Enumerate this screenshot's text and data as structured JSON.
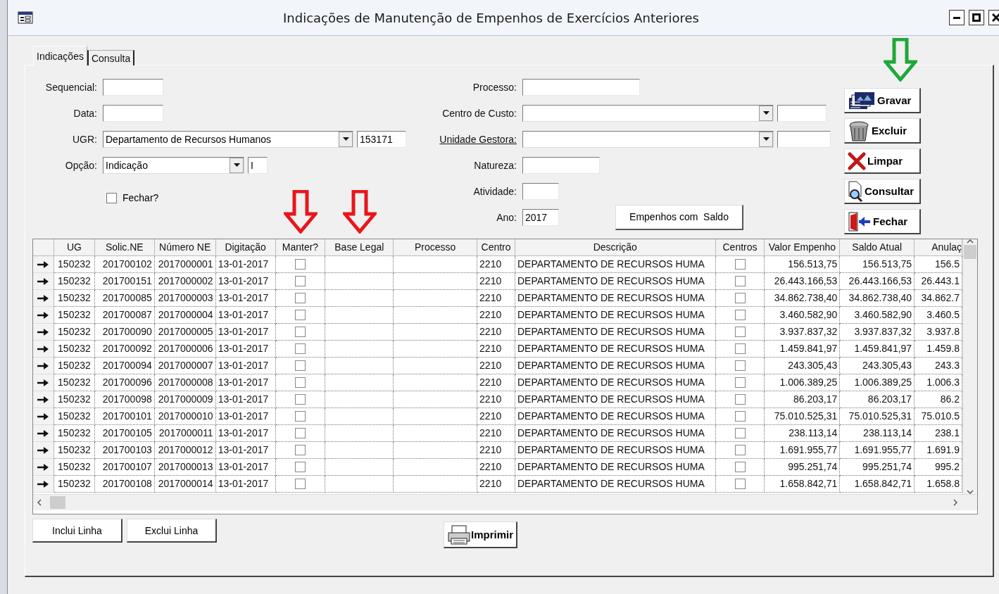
{
  "window": {
    "title": "Indicações de Manutenção de Empenhos de Exercícios Anteriores"
  },
  "tabs": [
    {
      "label": "Indicações",
      "selected": true
    },
    {
      "label": "Consulta",
      "selected": false
    }
  ],
  "form": {
    "left": [
      {
        "kind": "text",
        "label": "Sequencial:"
      },
      {
        "kind": "text",
        "label": "Data:"
      },
      {
        "kind": "combo",
        "label": "UGR:",
        "value": "Departamento de Recursos Humanos",
        "code": "153171"
      },
      {
        "kind": "combo",
        "label": "Opção:",
        "value": "Indicação",
        "code": "I"
      }
    ],
    "fechar": {
      "label": "Fechar?",
      "checked": false
    },
    "right": [
      {
        "kind": "text",
        "label": "Processo:"
      },
      {
        "kind": "combo",
        "label": "Centro de Custo:",
        "underlined": false
      },
      {
        "kind": "combo",
        "label": "Unidade Gestora:",
        "underlined": true
      },
      {
        "kind": "text",
        "label": "Natureza:"
      },
      {
        "kind": "text",
        "label": "Atividade:"
      },
      {
        "kind": "text",
        "label": "Ano:",
        "value": "2017"
      }
    ],
    "empenhos_button": "Empenhos com  Saldo"
  },
  "action_buttons": [
    {
      "kind": "save",
      "label": "Gravar"
    },
    {
      "kind": "delete",
      "label": "Excluir"
    },
    {
      "kind": "clear",
      "label": "Limpar"
    },
    {
      "kind": "query",
      "label": "Consultar"
    },
    {
      "kind": "exit",
      "label": "Fechar"
    }
  ],
  "annotations": [
    {
      "kind": "arrow",
      "color": "#e8161b"
    },
    {
      "kind": "arrow",
      "color": "#e8161b"
    },
    {
      "kind": "arrow",
      "color": "#1fa83a"
    }
  ],
  "table": {
    "columns": [
      "UG",
      "Solic.NE",
      "Número NE",
      "Digitação",
      "Manter?",
      "Base Legal",
      "Processo",
      "Centro",
      "Descrição",
      "Centros",
      "Valor Empenho",
      "Saldo Atual",
      "Anulaç"
    ],
    "rows": [
      {
        "ug": "150232",
        "solic": "201700102",
        "numero": "2017000001",
        "digitacao": "13-01-2017",
        "manter": false,
        "centro": "2210",
        "descricao": "DEPARTAMENTO DE RECURSOS HUMA",
        "centros": false,
        "valor": "156.513,75",
        "saldo": "156.513,75",
        "anulac": "156.5"
      },
      {
        "ug": "150232",
        "solic": "201700151",
        "numero": "2017000002",
        "digitacao": "13-01-2017",
        "manter": false,
        "centro": "2210",
        "descricao": "DEPARTAMENTO DE RECURSOS HUMA",
        "centros": false,
        "valor": "26.443.166,53",
        "saldo": "26.443.166,53",
        "anulac": "26.443.1"
      },
      {
        "ug": "150232",
        "solic": "201700085",
        "numero": "2017000003",
        "digitacao": "13-01-2017",
        "manter": false,
        "centro": "2210",
        "descricao": "DEPARTAMENTO DE RECURSOS HUMA",
        "centros": false,
        "valor": "34.862.738,40",
        "saldo": "34.862.738,40",
        "anulac": "34.862.7"
      },
      {
        "ug": "150232",
        "solic": "201700087",
        "numero": "2017000004",
        "digitacao": "13-01-2017",
        "manter": false,
        "centro": "2210",
        "descricao": "DEPARTAMENTO DE RECURSOS HUMA",
        "centros": false,
        "valor": "3.460.582,90",
        "saldo": "3.460.582,90",
        "anulac": "3.460.5"
      },
      {
        "ug": "150232",
        "solic": "201700090",
        "numero": "2017000005",
        "digitacao": "13-01-2017",
        "manter": false,
        "centro": "2210",
        "descricao": "DEPARTAMENTO DE RECURSOS HUMA",
        "centros": false,
        "valor": "3.937.837,32",
        "saldo": "3.937.837,32",
        "anulac": "3.937.8"
      },
      {
        "ug": "150232",
        "solic": "201700092",
        "numero": "2017000006",
        "digitacao": "13-01-2017",
        "manter": false,
        "centro": "2210",
        "descricao": "DEPARTAMENTO DE RECURSOS HUMA",
        "centros": false,
        "valor": "1.459.841,97",
        "saldo": "1.459.841,97",
        "anulac": "1.459.8"
      },
      {
        "ug": "150232",
        "solic": "201700094",
        "numero": "2017000007",
        "digitacao": "13-01-2017",
        "manter": false,
        "centro": "2210",
        "descricao": "DEPARTAMENTO DE RECURSOS HUMA",
        "centros": false,
        "valor": "243.305,43",
        "saldo": "243.305,43",
        "anulac": "243.3"
      },
      {
        "ug": "150232",
        "solic": "201700096",
        "numero": "2017000008",
        "digitacao": "13-01-2017",
        "manter": false,
        "centro": "2210",
        "descricao": "DEPARTAMENTO DE RECURSOS HUMA",
        "centros": false,
        "valor": "1.006.389,25",
        "saldo": "1.006.389,25",
        "anulac": "1.006.3"
      },
      {
        "ug": "150232",
        "solic": "201700098",
        "numero": "2017000009",
        "digitacao": "13-01-2017",
        "manter": false,
        "centro": "2210",
        "descricao": "DEPARTAMENTO DE RECURSOS HUMA",
        "centros": false,
        "valor": "86.203,17",
        "saldo": "86.203,17",
        "anulac": "86.2"
      },
      {
        "ug": "150232",
        "solic": "201700101",
        "numero": "2017000010",
        "digitacao": "13-01-2017",
        "manter": false,
        "centro": "2210",
        "descricao": "DEPARTAMENTO DE RECURSOS HUMA",
        "centros": false,
        "valor": "75.010.525,31",
        "saldo": "75.010.525,31",
        "anulac": "75.010.5"
      },
      {
        "ug": "150232",
        "solic": "201700105",
        "numero": "2017000011",
        "digitacao": "13-01-2017",
        "manter": false,
        "centro": "2210",
        "descricao": "DEPARTAMENTO DE RECURSOS HUMA",
        "centros": false,
        "valor": "238.113,14",
        "saldo": "238.113,14",
        "anulac": "238.1"
      },
      {
        "ug": "150232",
        "solic": "201700103",
        "numero": "2017000012",
        "digitacao": "13-01-2017",
        "manter": false,
        "centro": "2210",
        "descricao": "DEPARTAMENTO DE RECURSOS HUMA",
        "centros": false,
        "valor": "1.691.955,77",
        "saldo": "1.691.955,77",
        "anulac": "1.691.9"
      },
      {
        "ug": "150232",
        "solic": "201700107",
        "numero": "2017000013",
        "digitacao": "13-01-2017",
        "manter": false,
        "centro": "2210",
        "descricao": "DEPARTAMENTO DE RECURSOS HUMA",
        "centros": false,
        "valor": "995.251,74",
        "saldo": "995.251,74",
        "anulac": "995.2"
      },
      {
        "ug": "150232",
        "solic": "201700108",
        "numero": "2017000014",
        "digitacao": "13-01-2017",
        "manter": false,
        "centro": "2210",
        "descricao": "DEPARTAMENTO DE RECURSOS HUMA",
        "centros": false,
        "valor": "1.658.842,71",
        "saldo": "1.658.842,71",
        "anulac": "1.658.8"
      }
    ]
  },
  "bottom_buttons": [
    {
      "kind": "add",
      "label": "Inclui Linha"
    },
    {
      "kind": "remove",
      "label": "Exclui Linha"
    },
    {
      "kind": "print",
      "label": "Imprimir"
    }
  ]
}
